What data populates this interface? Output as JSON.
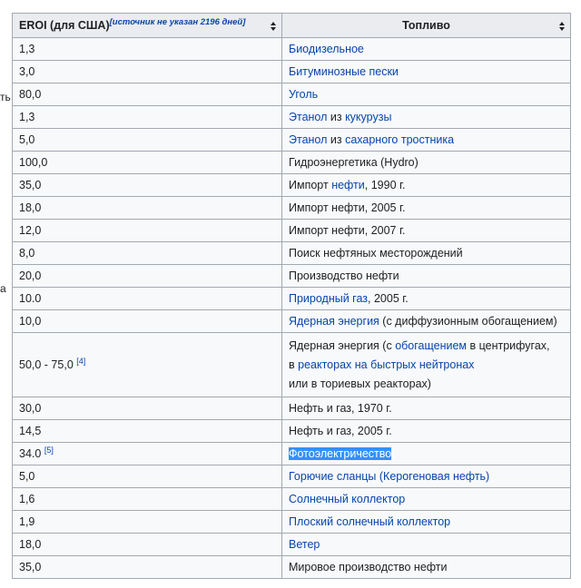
{
  "edge_fragments": [
    "ть",
    "а"
  ],
  "header": {
    "col1_label": "EROI (для США)",
    "col1_note": "[источник не указан 2196 дней]",
    "col2_label": "Топливо"
  },
  "rows": [
    {
      "value": "1,3",
      "fuel_link": "Биодизельное"
    },
    {
      "value": "3,0",
      "fuel_link": "Битуминозные пески"
    },
    {
      "value": "80,0",
      "fuel_link": "Уголь"
    },
    {
      "value": "1,3",
      "fuel_link": "Этанол",
      "fuel_mid": " из ",
      "fuel_link2": "кукурузы"
    },
    {
      "value": "5,0",
      "fuel_link": "Этанол",
      "fuel_mid": " из ",
      "fuel_link2": "сахарного тростника"
    },
    {
      "value": "100,0",
      "fuel_text": "Гидроэнергетика (Hydro)"
    },
    {
      "value": "35,0",
      "fuel_pre": "Импорт ",
      "fuel_link": "нефти",
      "fuel_post": ", 1990 г."
    },
    {
      "value": "18,0",
      "fuel_text": "Импорт нефти, 2005 г."
    },
    {
      "value": "12,0",
      "fuel_text": "Импорт нефти, 2007 г."
    },
    {
      "value": "8,0",
      "fuel_text": "Поиск нефтяных месторождений"
    },
    {
      "value": "20,0",
      "fuel_text": "Производство нефти"
    },
    {
      "value": "10.0",
      "fuel_link": "Природный газ",
      "fuel_post": ", 2005 г."
    },
    {
      "value": "10,0",
      "fuel_link": "Ядерная энергия",
      "fuel_post": " (с диффузионным обогащением)"
    },
    {
      "value": "50,0 - 75,0",
      "ref": "[4]",
      "l1_pre": "Ядерная энергия (с ",
      "l1_link": "обогащением",
      "l1_post": " в центрифугах,",
      "l2_pre": "в ",
      "l2_link": "реакторах на быстрых нейтронах",
      "l3": "или в ториевых реакторах)"
    },
    {
      "value": "30,0",
      "fuel_text": "Нефть и газ, 1970 г."
    },
    {
      "value": "14,5",
      "fuel_text": "Нефть и газ, 2005 г."
    },
    {
      "value": "34.0",
      "ref": "[5]",
      "fuel_link": "Фотоэлектричество"
    },
    {
      "value": "5,0",
      "fuel_link": "Горючие сланцы (Керогеновая нефть)"
    },
    {
      "value": "1,6",
      "fuel_link": "Солнечный коллектор"
    },
    {
      "value": "1,9",
      "fuel_link": "Плоский солнечный коллектор"
    },
    {
      "value": "18,0",
      "fuel_link": "Ветер"
    },
    {
      "value": "35,0",
      "fuel_text": "Мировое производство нефти"
    }
  ]
}
